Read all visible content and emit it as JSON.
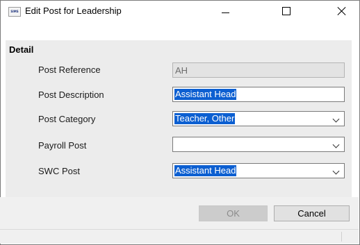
{
  "window": {
    "app_icon_text": "SIMS",
    "title": "Edit Post for Leadership"
  },
  "detail": {
    "header": "Detail",
    "fields": [
      {
        "label": "Post Reference",
        "value": "AH",
        "type": "readonly"
      },
      {
        "label": "Post Description",
        "value": "Assistant Head",
        "type": "text",
        "selected": true
      },
      {
        "label": "Post Category",
        "value": "Teacher, Other",
        "type": "dropdown",
        "selected": true
      },
      {
        "label": "Payroll Post",
        "value": "",
        "type": "dropdown"
      },
      {
        "label": "SWC Post",
        "value": "Assistant Head",
        "type": "dropdown",
        "selected": true
      }
    ]
  },
  "buttons": {
    "ok": "OK",
    "cancel": "Cancel"
  },
  "colors": {
    "selection": "#0c5fd1",
    "panel": "#ececec",
    "readonly_field": "#e3e3e3"
  }
}
